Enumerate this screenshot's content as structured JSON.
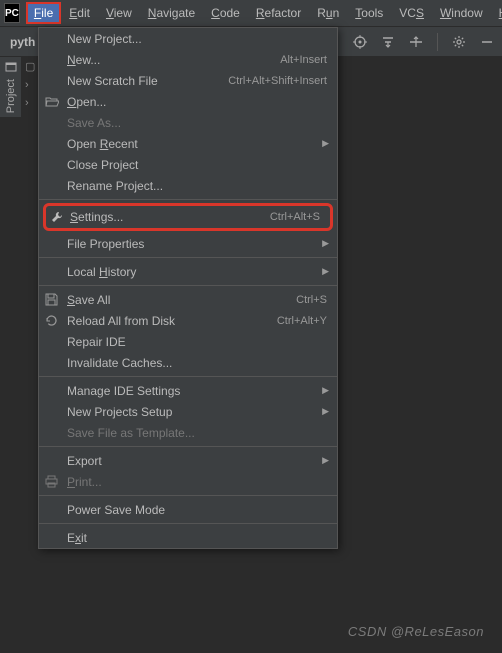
{
  "menubar": {
    "logo": "PC",
    "items": [
      {
        "label": "File",
        "mn": "F",
        "active": true
      },
      {
        "label": "Edit",
        "mn": "E"
      },
      {
        "label": "View",
        "mn": "V"
      },
      {
        "label": "Navigate",
        "mn": "N"
      },
      {
        "label": "Code",
        "mn": "C"
      },
      {
        "label": "Refactor",
        "mn": "R"
      },
      {
        "label": "Run",
        "mn": "u"
      },
      {
        "label": "Tools",
        "mn": "T"
      },
      {
        "label": "VCS",
        "mn": "S"
      },
      {
        "label": "Window",
        "mn": "W"
      },
      {
        "label": "Help",
        "mn": "H"
      }
    ]
  },
  "breadcrumb": {
    "root": "pyth"
  },
  "sidebar": {
    "project_label": "Project"
  },
  "dropdown": [
    {
      "label": "New Project...",
      "mn": ""
    },
    {
      "label": "New...",
      "mn": "N",
      "shortcut": "Alt+Insert"
    },
    {
      "label": "New Scratch File",
      "mn": "",
      "shortcut": "Ctrl+Alt+Shift+Insert"
    },
    {
      "label": "Open...",
      "mn": "O",
      "icon": "folder-open-icon"
    },
    {
      "label": "Save As...",
      "mn": "",
      "disabled": true
    },
    {
      "label": "Open Recent",
      "mn": "R",
      "submenu": true
    },
    {
      "label": "Close Project",
      "mn": ""
    },
    {
      "label": "Rename Project...",
      "mn": ""
    },
    {
      "sep": true
    },
    {
      "label": "Settings...",
      "mn": "S",
      "shortcut": "Ctrl+Alt+S",
      "icon": "wrench-icon",
      "highlight": true
    },
    {
      "label": "File Properties",
      "mn": "",
      "submenu": true
    },
    {
      "sep": true
    },
    {
      "label": "Local History",
      "mn": "H",
      "submenu": true
    },
    {
      "sep": true
    },
    {
      "label": "Save All",
      "mn": "S",
      "shortcut": "Ctrl+S",
      "icon": "save-icon"
    },
    {
      "label": "Reload All from Disk",
      "mn": "",
      "shortcut": "Ctrl+Alt+Y",
      "icon": "reload-icon"
    },
    {
      "label": "Repair IDE",
      "mn": ""
    },
    {
      "label": "Invalidate Caches...",
      "mn": ""
    },
    {
      "sep": true
    },
    {
      "label": "Manage IDE Settings",
      "mn": "",
      "submenu": true
    },
    {
      "label": "New Projects Setup",
      "mn": "",
      "submenu": true
    },
    {
      "label": "Save File as Template...",
      "mn": "",
      "disabled": true
    },
    {
      "sep": true
    },
    {
      "label": "Export",
      "mn": "",
      "submenu": true
    },
    {
      "label": "Print...",
      "mn": "P",
      "icon": "print-icon",
      "disabled": true
    },
    {
      "sep": true
    },
    {
      "label": "Power Save Mode",
      "mn": ""
    },
    {
      "sep": true
    },
    {
      "label": "Exit",
      "mn": "x"
    }
  ],
  "watermark": "CSDN @ReLesEason"
}
